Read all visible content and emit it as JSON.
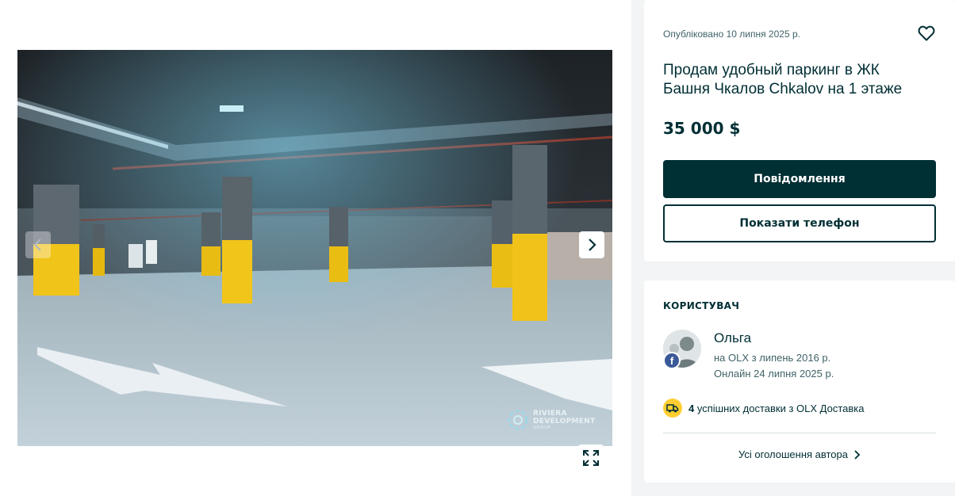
{
  "gallery": {
    "watermark_brand": "RIVIERA",
    "watermark_sub": "DEVELOPMENT",
    "watermark_group": "GROUP"
  },
  "listing": {
    "posted": "Опубліковано 10 липня 2025 р.",
    "title": "Продам удобный паркинг в ЖК Башня Чкалов Chkalov на 1 этаже",
    "price": "35 000 $",
    "message_button": "Повідомлення",
    "phone_button": "Показати телефон"
  },
  "user": {
    "heading": "КОРИСТУВАЧ",
    "name": "Ольга",
    "member_since": "на OLX з липень 2016 р.",
    "last_online": "Онлайн 24 липня 2025 р.",
    "deliveries_count": "4",
    "deliveries_text": "успішних доставки з OLX Доставка",
    "all_ads_link": "Усі оголошення автора",
    "badge_letter": "f"
  },
  "colors": {
    "primary": "#002f34",
    "accent_yellow": "#ffce32",
    "facebook": "#3b5998"
  }
}
